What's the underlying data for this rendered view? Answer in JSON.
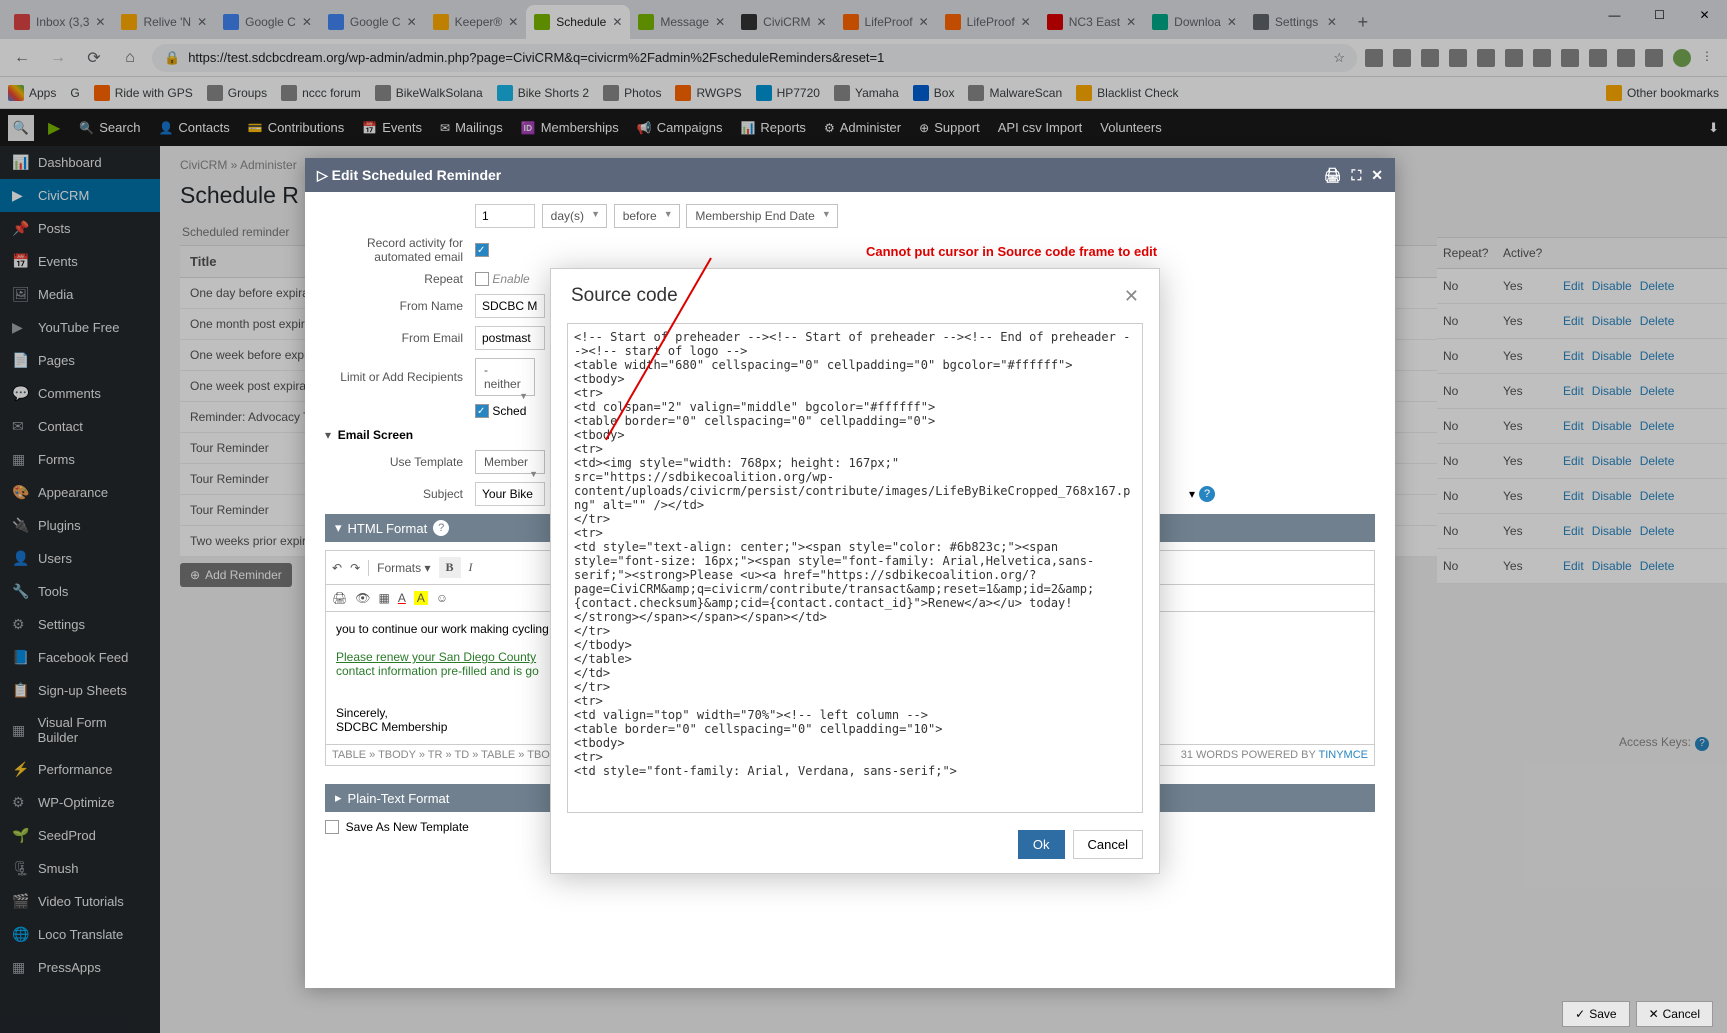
{
  "browser": {
    "tabs": [
      {
        "label": "Inbox (3,3",
        "fav": "#d44"
      },
      {
        "label": "Relive 'N",
        "fav": "#fa0"
      },
      {
        "label": "Google C",
        "fav": "#4285f4"
      },
      {
        "label": "Google C",
        "fav": "#4285f4"
      },
      {
        "label": "Keeper®",
        "fav": "#fa0"
      },
      {
        "label": "Schedule",
        "fav": "#7ab800",
        "active": true
      },
      {
        "label": "Message",
        "fav": "#7ab800"
      },
      {
        "label": "CiviCRM",
        "fav": "#333"
      },
      {
        "label": "LifeProof",
        "fav": "#f60"
      },
      {
        "label": "LifeProof",
        "fav": "#f60"
      },
      {
        "label": "NC3 East",
        "fav": "#d00"
      },
      {
        "label": "Downloa",
        "fav": "#0a8"
      },
      {
        "label": "Settings",
        "fav": "#5f6368"
      }
    ],
    "url": "https://test.sdcbcdream.org/wp-admin/admin.php?page=CiviCRM&q=civicrm%2Fadmin%2FscheduleReminders&reset=1",
    "bookmarks": [
      "Apps",
      "G",
      "Ride with GPS",
      "Groups",
      "nccc forum",
      "BikeWalkSolana",
      "Bike Shorts 2",
      "Photos",
      "RWGPS",
      "HP7720",
      "Yamaha",
      "Box",
      "MalwareScan",
      "Blacklist Check"
    ],
    "other_bookmarks": "Other bookmarks"
  },
  "civitop": {
    "items": [
      "Search",
      "Contacts",
      "Contributions",
      "Events",
      "Mailings",
      "Memberships",
      "Campaigns",
      "Reports",
      "Administer",
      "Support",
      "API csv Import",
      "Volunteers"
    ]
  },
  "wpside": [
    "Dashboard",
    "CiviCRM",
    "Posts",
    "Events",
    "Media",
    "YouTube Free",
    "Pages",
    "Comments",
    "Contact",
    "Forms",
    "Appearance",
    "Plugins",
    "Users",
    "Tools",
    "Settings",
    "Facebook Feed",
    "Sign-up Sheets",
    "Visual Form Builder",
    "Performance",
    "WP-Optimize",
    "SeedProd",
    "Smush",
    "Video Tutorials",
    "Loco Translate",
    "PressApps"
  ],
  "page": {
    "breadcrumb": "CiviCRM » Administer",
    "title": "Schedule R",
    "hint": "Scheduled reminder",
    "tbl_hdr": "Title",
    "rows": [
      "One day before expiration",
      "One month post expiration",
      "One week before expiration",
      "One week post expiration",
      "Reminder: Advocacy Training",
      "Tour Reminder",
      "Tour Reminder",
      "Tour Reminder",
      "Two weeks prior expiration"
    ],
    "addbtn": "Add Reminder"
  },
  "editpanel": {
    "title": "Edit Scheduled Reminder",
    "num": "1",
    "unit": "day(s)",
    "rel": "before",
    "date": "Membership End Date",
    "lbl_record": "Record activity for automated email",
    "lbl_repeat": "Repeat",
    "repeat_enable": "Enable",
    "lbl_fromname": "From Name",
    "fromname": "SDCBC M",
    "lbl_fromemail": "From Email",
    "fromemail": "postmast",
    "lbl_limit": "Limit or Add Recipients",
    "limit": "- neither",
    "sched": "Sched",
    "accordion_email": "Email Screen",
    "lbl_template": "Use Template",
    "template": "Member",
    "lbl_subject": "Subject",
    "subject": "Your Bike",
    "accordion_html": "HTML Format",
    "formats": "Formats",
    "body_txt": "you to continue our work making cycling",
    "renew_txt": "Please renew your San Diego County",
    "prefill_txt": "contact information pre-filled and is go",
    "sig1": "Sincerely,",
    "sig2": "SDCBC Membership",
    "path": "TABLE » TBODY » TR » TD » TABLE » TBO",
    "words": "31 WORDS POWERED BY",
    "tinymce": "TINYMCE",
    "accordion_plain": "Plain-Text Format",
    "saveas": "Save As New Template"
  },
  "rt": {
    "hdr_repeat": "Repeat?",
    "hdr_active": "Active?",
    "rows": [
      {
        "r": "No",
        "a": "Yes"
      },
      {
        "r": "No",
        "a": "Yes"
      },
      {
        "r": "No",
        "a": "Yes"
      },
      {
        "r": "No",
        "a": "Yes"
      },
      {
        "r": "No",
        "a": "Yes"
      },
      {
        "r": "No",
        "a": "Yes"
      },
      {
        "r": "No",
        "a": "Yes"
      },
      {
        "r": "No",
        "a": "Yes"
      },
      {
        "r": "No",
        "a": "Yes"
      }
    ],
    "edit": "Edit",
    "disable": "Disable",
    "delete": "Delete",
    "akeys": "Access Keys:"
  },
  "modal": {
    "title": "Source code",
    "source": "<!-- Start of preheader --><!-- Start of preheader --><!-- End of preheader --><!-- start of logo -->\n<table width=\"680\" cellspacing=\"0\" cellpadding=\"0\" bgcolor=\"#ffffff\">\n<tbody>\n<tr>\n<td colspan=\"2\" valign=\"middle\" bgcolor=\"#ffffff\">\n<table border=\"0\" cellspacing=\"0\" cellpadding=\"0\">\n<tbody>\n<tr>\n<td><img style=\"width: 768px; height: 167px;\" src=\"https://sdbikecoalition.org/wp-content/uploads/civicrm/persist/contribute/images/LifeByBikeCropped_768x167.png\" alt=\"\" /></td>\n</tr>\n<tr>\n<td style=\"text-align: center;\"><span style=\"color: #6b823c;\"><span style=\"font-size: 16px;\"><span style=\"font-family: Arial,Helvetica,sans-serif;\"><strong>Please <u><a href=\"https://sdbikecoalition.org/?page=CiviCRM&amp;q=civicrm/contribute/transact&amp;reset=1&amp;id=2&amp;{contact.checksum}&amp;cid={contact.contact_id}\">Renew</a></u> today!</strong></span></span></span></td>\n</tr>\n</tbody>\n</table>\n</td>\n</tr>\n<tr>\n<td valign=\"top\" width=\"70%\"><!-- left column -->\n<table border=\"0\" cellspacing=\"0\" cellpadding=\"10\">\n<tbody>\n<tr>\n<td style=\"font-family: Arial, Verdana, sans-serif;\">",
    "ok": "Ok",
    "cancel": "Cancel"
  },
  "annotation": "Cannot put cursor in Source code frame to edit",
  "bottom": {
    "save": "Save",
    "cancel": "Cancel"
  }
}
